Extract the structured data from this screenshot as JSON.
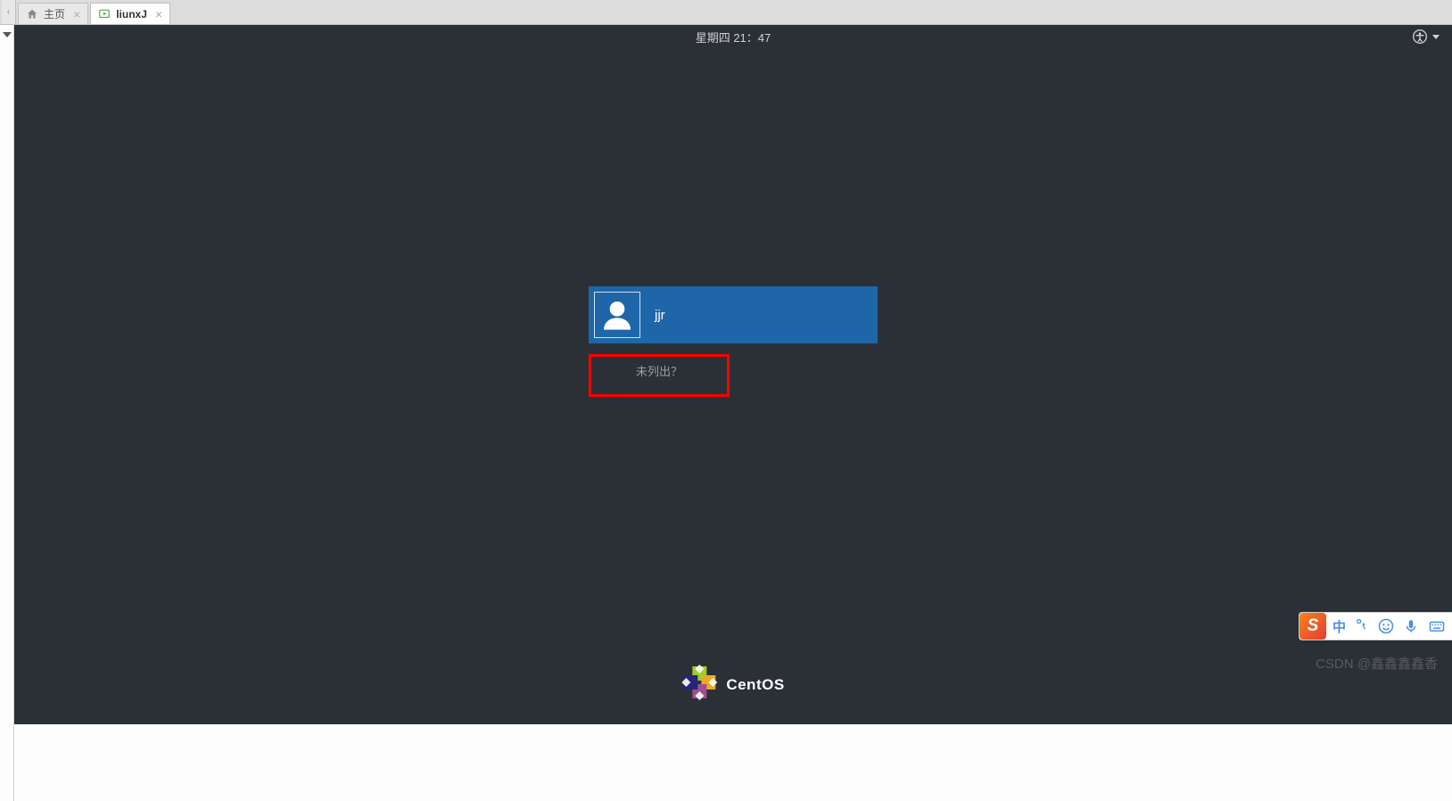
{
  "outer_tabs": {
    "home_label": "主页",
    "vm_label": "liunxJ"
  },
  "vm_topbar": {
    "datetime": "星期四 21：47"
  },
  "login": {
    "user_name": "jjr",
    "not_listed_label": "未列出？"
  },
  "branding": {
    "os_name": "CentOS"
  },
  "ime": {
    "logo_letter": "S",
    "mode_label": "中",
    "punct_label": "，"
  },
  "watermark": {
    "text": "CSDN @鑫鑫鑫鑫香"
  },
  "icons": {
    "tab_home": "home-icon",
    "tab_vm": "vm-play-icon",
    "tab_close": "close-icon",
    "accessibility": "accessibility-icon",
    "caret": "caret-down-icon",
    "user": "user-icon",
    "centos_logo": "centos-logo-icon",
    "ime_smiley": "smiley-icon",
    "ime_mic": "microphone-icon",
    "ime_kb": "keyboard-icon"
  },
  "colors": {
    "vm_bg": "#2b3036",
    "user_tile_bg": "#1e66a8",
    "highlight_box": "#fe0000",
    "ime_accent": "#4a90e2",
    "ime_logo_bg": "#f5831f"
  }
}
